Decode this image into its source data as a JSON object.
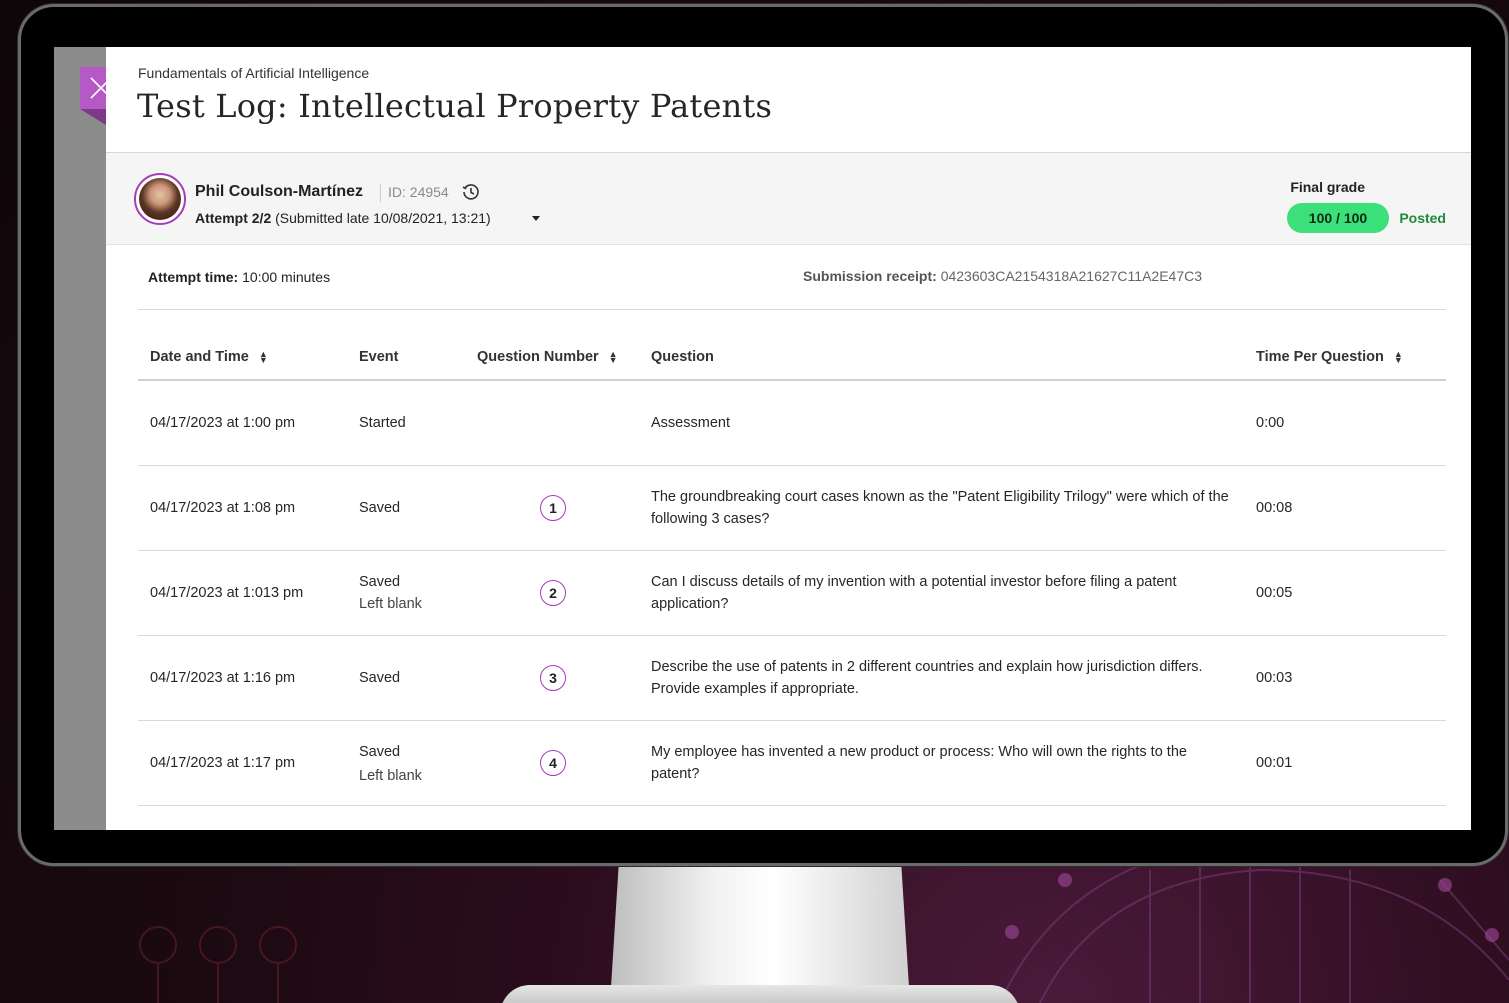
{
  "course": {
    "name": "Fundamentals of Artificial Intelligence"
  },
  "page": {
    "title": "Test Log: Intellectual Property Patents"
  },
  "student": {
    "name": "Phil Coulson-Martínez",
    "id_text": "ID: 24954",
    "attempt_label": "Attempt 2/2",
    "attempt_detail": " (Submitted late 10/08/2021, 13:21)"
  },
  "grade": {
    "label": "Final grade",
    "value": "100 / 100",
    "status": "Posted",
    "pill_color": "#3ce07a"
  },
  "attempt_info": {
    "time_label": "Attempt time:",
    "time_value": " 10:00 minutes",
    "receipt_label": "Submission receipt:",
    "receipt_value": " 0423603CA2154318A21627C11A2E47C3"
  },
  "table": {
    "headers": {
      "date": "Date and Time",
      "event": "Event",
      "qnum": "Question Number",
      "question": "Question",
      "time": "Time Per Question"
    },
    "rows": [
      {
        "date": "04/17/2023 at 1:00 pm",
        "event": "Started",
        "event2": "",
        "qnum": "",
        "question": "Assessment",
        "time": "0:00"
      },
      {
        "date": "04/17/2023 at 1:08 pm",
        "event": "Saved",
        "event2": "",
        "qnum": "1",
        "question": "The groundbreaking court cases known as the \"Patent Eligibility Trilogy\" were which of the following 3 cases?",
        "time": "00:08"
      },
      {
        "date": "04/17/2023 at 1:013 pm",
        "event": "Saved",
        "event2": "Left blank",
        "qnum": "2",
        "question": "Can I discuss details of my invention with a potential investor before filing a patent application?",
        "time": "00:05"
      },
      {
        "date": "04/17/2023 at 1:16 pm",
        "event": "Saved",
        "event2": "",
        "qnum": "3",
        "question": "Describe the use of patents in 2 different countries and explain how jurisdiction differs. Provide examples if appropriate.",
        "time": "00:03"
      },
      {
        "date": "04/17/2023 at 1:17 pm",
        "event": "Saved",
        "event2": "Left blank",
        "qnum": "4",
        "question": "My employee has invented a new product or process: Who will own the rights to the patent?",
        "time": "00:01"
      }
    ]
  },
  "icons": {
    "close": "close-icon",
    "history": "history-icon",
    "caret": "caret-down-icon",
    "sort": "sort-icon"
  },
  "colors": {
    "accent": "#a63db8",
    "close_tab": "#b559c7",
    "posted": "#1f8a3e"
  }
}
